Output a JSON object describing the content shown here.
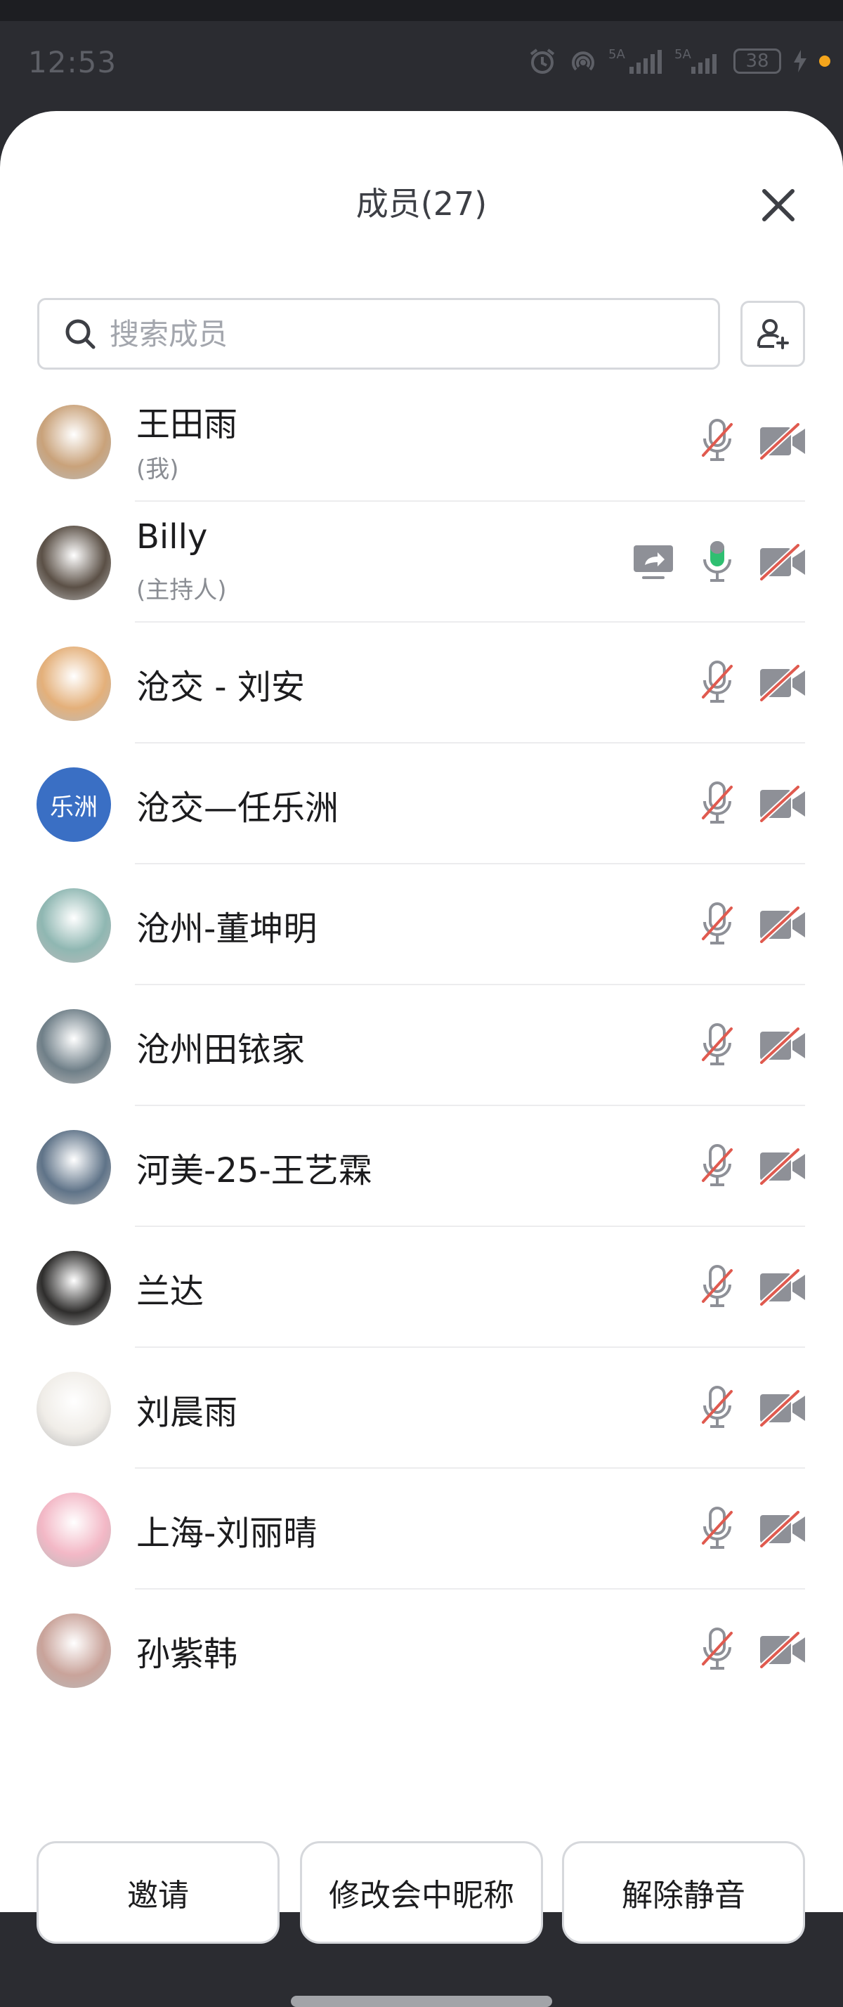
{
  "status_bar": {
    "time": "12:53",
    "battery": "38",
    "icons": [
      "alarm-icon",
      "hotspot-icon",
      "signal-5g-icon",
      "signal-5g-icon",
      "battery-icon",
      "charging-icon"
    ],
    "network_labels": [
      "5A",
      "5A"
    ]
  },
  "header": {
    "title": "成员(27)",
    "close_icon": "close-icon"
  },
  "search": {
    "placeholder": "搜索成员",
    "value": "",
    "icon": "search-icon"
  },
  "add_member_icon": "add-user-icon",
  "members": [
    {
      "name": "王田雨",
      "sub": "(我)",
      "mic": "muted",
      "camera": "off",
      "avatar": {
        "type": "photo",
        "color": "#c9a27a",
        "icon": "cat-photo"
      }
    },
    {
      "name": "Billy",
      "sub": "(主持人)",
      "mic": "on",
      "camera": "off",
      "sharing": true,
      "avatar": {
        "type": "photo",
        "color": "#5b5046",
        "icon": "person-reading-photo"
      }
    },
    {
      "name": "沧交 - 刘安",
      "mic": "muted",
      "camera": "off",
      "avatar": {
        "type": "photo",
        "color": "#e4b07a",
        "icon": "cat-photo"
      }
    },
    {
      "name": "沧交—任乐洲",
      "mic": "muted",
      "camera": "off",
      "avatar": {
        "type": "text",
        "text": "乐洲",
        "color": "#3a6fc4"
      }
    },
    {
      "name": "沧州-董坤明",
      "mic": "muted",
      "camera": "off",
      "avatar": {
        "type": "photo",
        "color": "#8fb7b2",
        "icon": "chip-photo"
      }
    },
    {
      "name": "沧州田铱家",
      "mic": "muted",
      "camera": "off",
      "avatar": {
        "type": "photo",
        "color": "#6f7f88",
        "icon": "street-photo"
      }
    },
    {
      "name": "河美-25-王艺霖",
      "mic": "muted",
      "camera": "off",
      "avatar": {
        "type": "photo",
        "color": "#5f7388",
        "icon": "sky-photo"
      }
    },
    {
      "name": "兰达",
      "mic": "muted",
      "camera": "off",
      "avatar": {
        "type": "photo",
        "color": "#2e2d2c",
        "icon": "person-photo"
      }
    },
    {
      "name": "刘晨雨",
      "mic": "muted",
      "camera": "off",
      "avatar": {
        "type": "photo",
        "color": "#f0ede8",
        "icon": "portrait-photo"
      }
    },
    {
      "name": "上海-刘丽晴",
      "mic": "muted",
      "camera": "off",
      "avatar": {
        "type": "photo",
        "color": "#f3b8c6",
        "icon": "anime-photo"
      }
    },
    {
      "name": "孙紫韩",
      "mic": "muted",
      "camera": "off",
      "avatar": {
        "type": "photo",
        "color": "#c9a39a",
        "icon": "portrait-photo"
      }
    }
  ],
  "colors": {
    "muted_slash": "#e05a4f",
    "mic_active": "#2fbf71",
    "icon_gray": "#8e9097",
    "text": "#1c1c1e"
  },
  "actions": {
    "invite": "邀请",
    "rename": "修改会中昵称",
    "unmute": "解除静音"
  }
}
